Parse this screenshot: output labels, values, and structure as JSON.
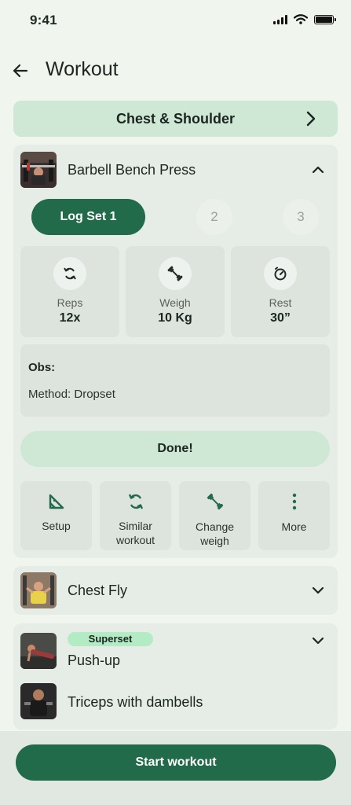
{
  "status_bar": {
    "time": "9:41"
  },
  "header": {
    "title": "Workout"
  },
  "banner": {
    "label": "Chest & Shoulder"
  },
  "exercise_main": {
    "name": "Barbell Bench Press",
    "sets": {
      "active_label": "Log Set 1",
      "set2": "2",
      "set3": "3"
    },
    "stats": [
      {
        "label": "Reps",
        "value": "12x",
        "icon": "repeat-icon"
      },
      {
        "label": "Weigh",
        "value": "10 Kg",
        "icon": "dumbbell-icon"
      },
      {
        "label": "Rest",
        "value": "30”",
        "icon": "timer-icon"
      }
    ],
    "obs": {
      "label": "Obs:",
      "method": "Method: Dropset"
    },
    "done_label": "Done!",
    "actions": [
      {
        "label": "Setup",
        "icon": "setup-icon"
      },
      {
        "label": "Similar workout",
        "line1": "Similar",
        "line2": "workout",
        "icon": "repeat-icon"
      },
      {
        "label": "Change weigh",
        "line1": "Change",
        "line2": "weigh",
        "icon": "dumbbell-icon"
      },
      {
        "label": "More",
        "icon": "more-vertical-icon"
      }
    ]
  },
  "exercise_fly": {
    "name": "Chest Fly"
  },
  "superset": {
    "badge": "Superset",
    "items": [
      {
        "name": "Push-up"
      },
      {
        "name": "Triceps with dambells"
      }
    ]
  },
  "bottom": {
    "start_label": "Start workout"
  },
  "colors": {
    "accent": "#216a4a",
    "accent_light": "#cfe8d5",
    "card": "#e6ede6",
    "tile": "#dde4de",
    "badge": "#b3ebc4"
  }
}
